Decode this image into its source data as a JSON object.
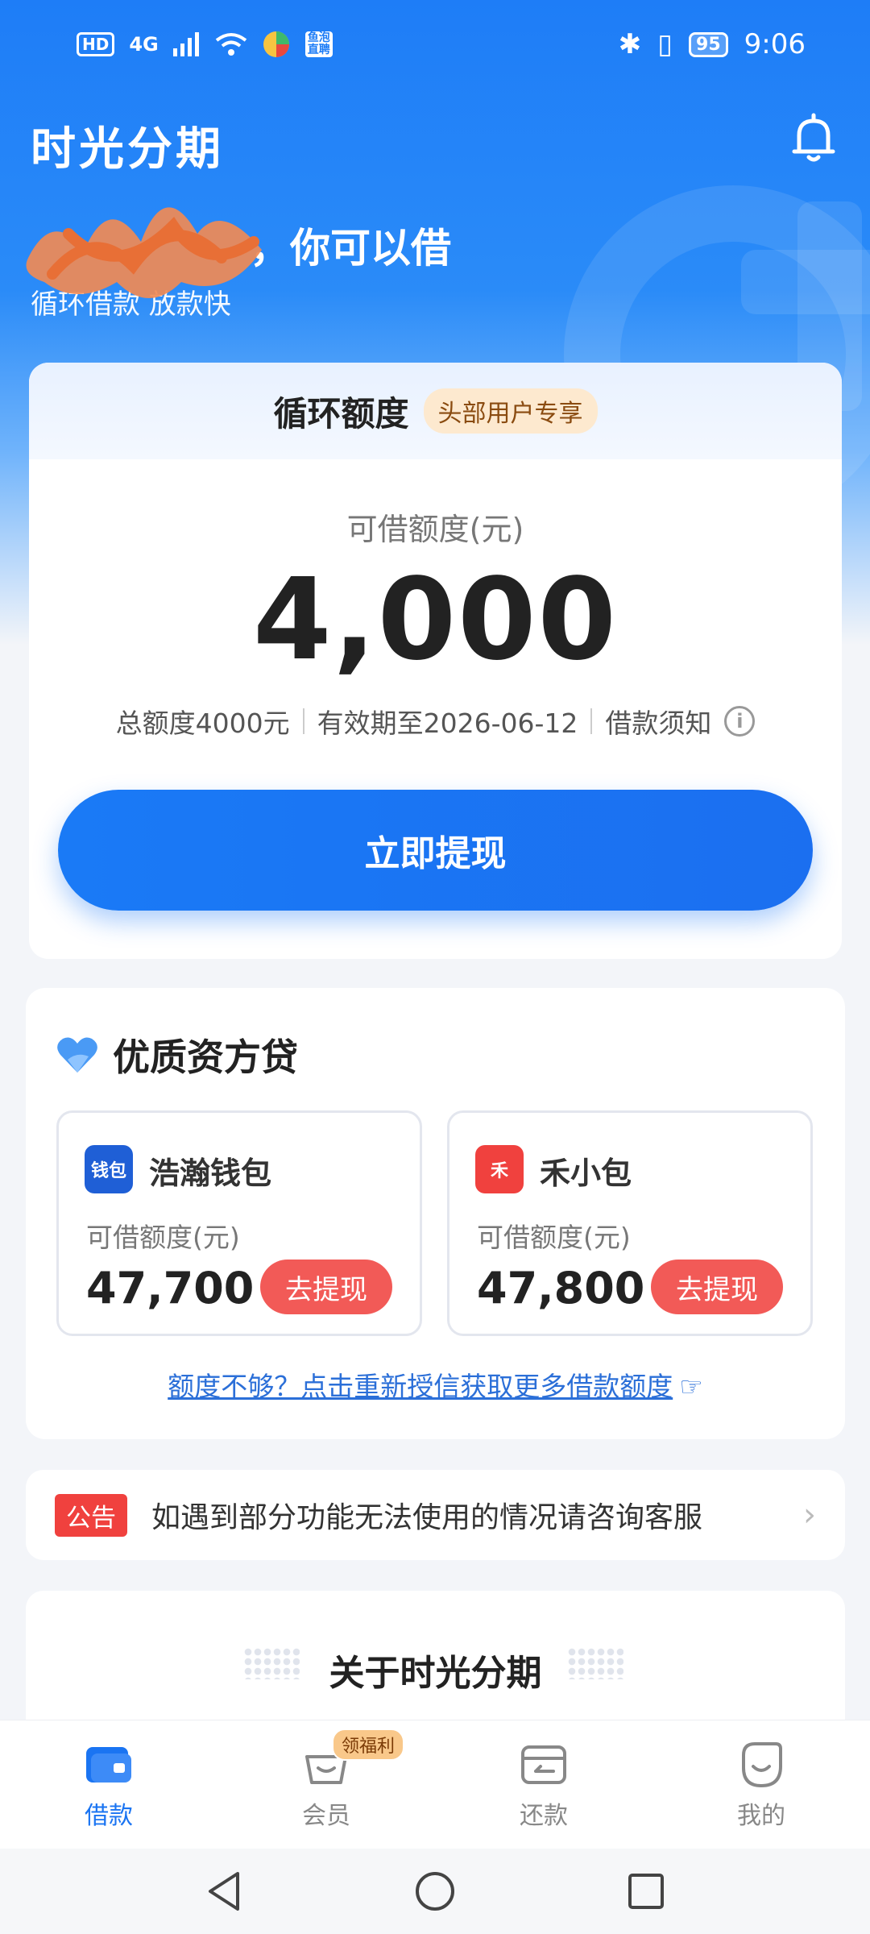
{
  "status_bar": {
    "network_left": "HD",
    "network_type": "4G",
    "app_badge": "鱼泡\n直聘",
    "battery": "95",
    "time": "9:06"
  },
  "header": {
    "app_title": "时光分期",
    "headline": "，你可以借",
    "subline": "循环借款 放款快"
  },
  "credit_card": {
    "title": "循环额度",
    "vip_tag": "头部用户专享",
    "available_label": "可借额度(元)",
    "amount": "4,000",
    "total_limit": "总额度4000元",
    "valid_until": "有效期至2026-06-12",
    "loan_notice": "借款须知",
    "info_icon": "i",
    "withdraw_button": "立即提现"
  },
  "partners": {
    "title": "优质资方贷",
    "items": [
      {
        "logo_text": "钱包",
        "name": "浩瀚钱包",
        "label": "可借额度(元)",
        "amount": "47,700",
        "button": "去提现",
        "color": "#1f5fd6"
      },
      {
        "logo_text": "禾",
        "name": "禾小包",
        "label": "可借额度(元)",
        "amount": "47,800",
        "button": "去提现",
        "color": "#f0413e"
      }
    ],
    "more_link": "额度不够？点击重新授信获取更多借款额度"
  },
  "notice": {
    "tag": "公告",
    "text": "如遇到部分功能无法使用的情况请咨询客服"
  },
  "about": {
    "title": "关于时光分期"
  },
  "bottom_nav": {
    "items": [
      {
        "label": "借款",
        "icon": "wallet-icon",
        "active": true
      },
      {
        "label": "会员",
        "icon": "basket-icon",
        "badge": "领福利"
      },
      {
        "label": "还款",
        "icon": "repay-icon"
      },
      {
        "label": "我的",
        "icon": "profile-icon"
      }
    ]
  },
  "colors": {
    "primary": "#1a74f2",
    "danger": "#f25a57",
    "vip_bg": "#fde9cf"
  }
}
